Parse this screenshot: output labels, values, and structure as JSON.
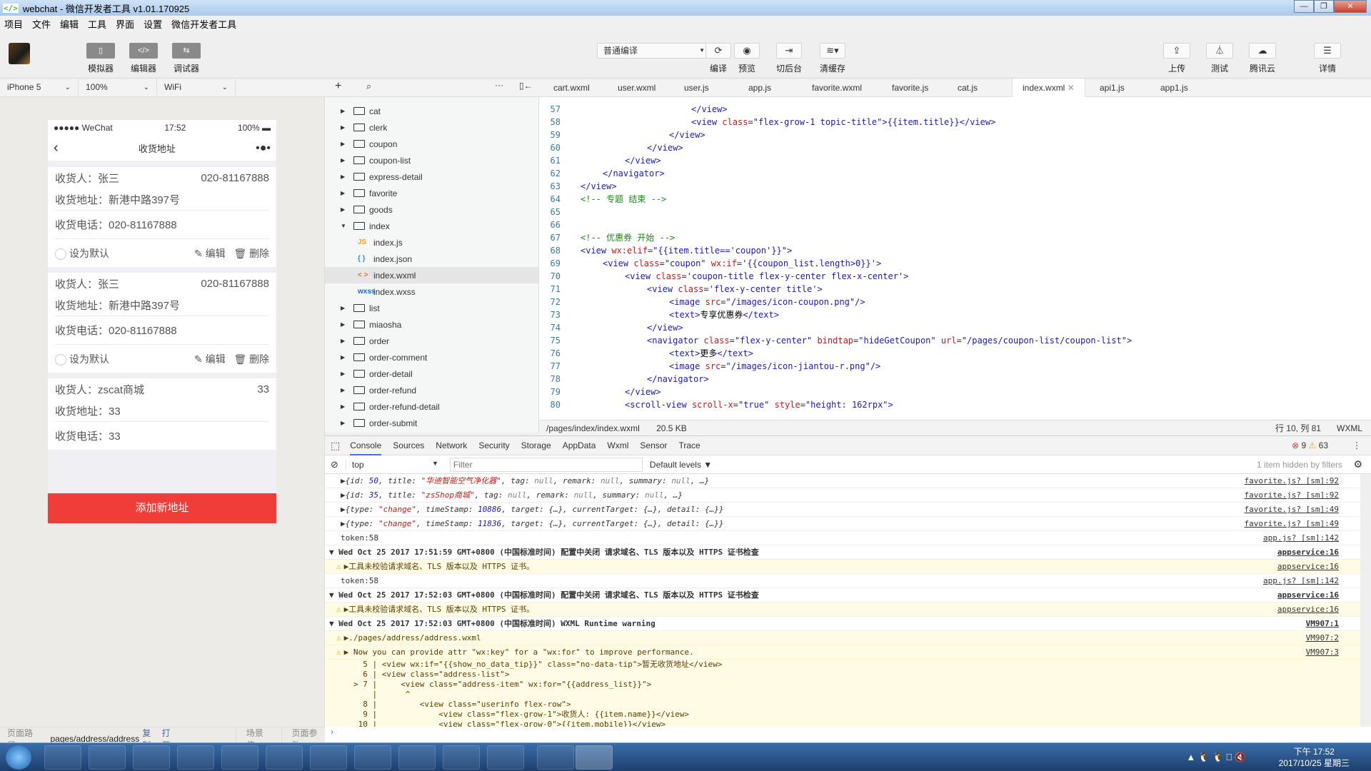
{
  "window": {
    "title": "webchat - 微信开发者工具 v1.01.170925",
    "logo": "</>"
  },
  "menu": [
    "项目",
    "文件",
    "编辑",
    "工具",
    "界面",
    "设置",
    "微信开发者工具"
  ],
  "toolbar": {
    "left": [
      {
        "label": "模拟器",
        "icon": "phone-icon",
        "glyph": "▯"
      },
      {
        "label": "编辑器",
        "icon": "code-icon",
        "glyph": "</>"
      },
      {
        "label": "调试器",
        "icon": "debug-icon",
        "glyph": "⇆"
      }
    ],
    "compile_mode": "普通编译",
    "middle": [
      {
        "label": "编译",
        "icon": "refresh-icon",
        "glyph": "⟳"
      },
      {
        "label": "预览",
        "icon": "eye-icon",
        "glyph": "◉"
      },
      {
        "label": "切后台",
        "icon": "background-icon",
        "glyph": "⇥"
      },
      {
        "label": "清缓存",
        "icon": "layers-icon",
        "glyph": "≋▾"
      }
    ],
    "right": [
      {
        "label": "上传",
        "icon": "upload-icon",
        "glyph": "⇪"
      },
      {
        "label": "测试",
        "icon": "flask-icon",
        "glyph": "⏃"
      },
      {
        "label": "腾讯云",
        "icon": "cloud-icon",
        "glyph": "☁"
      },
      {
        "label": "详情",
        "icon": "menu-icon",
        "glyph": "☰"
      }
    ]
  },
  "simulator": {
    "device": "iPhone 5",
    "zoom": "100%",
    "network": "WiFi",
    "status": {
      "carrier": "●●●●● WeChat",
      "time": "17:52",
      "battery": "100%"
    },
    "nav_title": "收货地址",
    "addresses": [
      {
        "name": "收货人：张三",
        "mobile": "020-81167888",
        "address": "收货地址：新港中路397号",
        "phone": "收货电话：020-81167888",
        "default": "设为默认",
        "edit": "编辑",
        "delete": "删除"
      },
      {
        "name": "收货人：张三",
        "mobile": "020-81167888",
        "address": "收货地址：新港中路397号",
        "phone": "收货电话：020-81167888",
        "default": "设为默认",
        "edit": "编辑",
        "delete": "删除"
      },
      {
        "name": "收货人：zscat商城",
        "mobile": "33",
        "address": "收货地址：33",
        "phone": "收货电话：33"
      }
    ],
    "add_button": "添加新地址",
    "footer": {
      "label": "页面路径",
      "path": "pages/address/address",
      "copy": "复制",
      "open": "打开",
      "scene": "场景值",
      "params": "页面参数"
    }
  },
  "filetree": {
    "items": [
      {
        "type": "folder",
        "name": "cat"
      },
      {
        "type": "folder",
        "name": "clerk"
      },
      {
        "type": "folder",
        "name": "coupon"
      },
      {
        "type": "folder",
        "name": "coupon-list"
      },
      {
        "type": "folder",
        "name": "express-detail"
      },
      {
        "type": "folder",
        "name": "favorite"
      },
      {
        "type": "folder",
        "name": "goods"
      },
      {
        "type": "folder-open",
        "name": "index"
      },
      {
        "type": "file",
        "name": "index.js",
        "icon": "JS",
        "color": "#f0a30a"
      },
      {
        "type": "file",
        "name": "index.json",
        "icon": "{ }",
        "color": "#1a9ad6"
      },
      {
        "type": "file",
        "name": "index.wxml",
        "icon": "< >",
        "color": "#f06a2a",
        "selected": true
      },
      {
        "type": "file",
        "name": "index.wxss",
        "icon": "wxss",
        "color": "#1a6ad6"
      },
      {
        "type": "folder",
        "name": "list"
      },
      {
        "type": "folder",
        "name": "miaosha"
      },
      {
        "type": "folder",
        "name": "order"
      },
      {
        "type": "folder",
        "name": "order-comment"
      },
      {
        "type": "folder",
        "name": "order-detail"
      },
      {
        "type": "folder",
        "name": "order-refund"
      },
      {
        "type": "folder",
        "name": "order-refund-detail"
      },
      {
        "type": "folder",
        "name": "order-submit"
      }
    ]
  },
  "editor": {
    "tabs": [
      "cart.wxml",
      "user.wxml",
      "user.js",
      "app.js",
      "favorite.wxml",
      "favorite.js",
      "cat.js",
      "index.wxml",
      "api1.js",
      "app1.js"
    ],
    "active_tab": "index.wxml",
    "lines": [
      {
        "n": "57",
        "indent": 5,
        "html": "<span class='tg'>&lt;/view&gt;</span>"
      },
      {
        "n": "58",
        "indent": 5,
        "html": "<span class='tg'>&lt;view</span> <span class='at'>class</span>=<span class='st'>\"flex-grow-1 topic-title\"</span><span class='tg'>&gt;</span><span class='st'>{{item.title}}</span><span class='tg'>&lt;/view&gt;</span>"
      },
      {
        "n": "59",
        "indent": 4,
        "html": "<span class='tg'>&lt;/view&gt;</span>"
      },
      {
        "n": "60",
        "indent": 3,
        "html": "<span class='tg'>&lt;/view&gt;</span>"
      },
      {
        "n": "61",
        "indent": 2,
        "html": "<span class='tg'>&lt;/view&gt;</span>"
      },
      {
        "n": "62",
        "indent": 1,
        "html": "<span class='tg'>&lt;/navigator&gt;</span>"
      },
      {
        "n": "63",
        "indent": 0,
        "html": "<span class='tg'>&lt;/view&gt;</span>"
      },
      {
        "n": "64",
        "indent": 0,
        "html": "<span class='cm'>&lt;!-- 专题 结束 --&gt;</span>"
      },
      {
        "n": "65",
        "indent": 0,
        "html": ""
      },
      {
        "n": "66",
        "indent": 0,
        "html": ""
      },
      {
        "n": "67",
        "indent": 0,
        "html": "<span class='cm'>&lt;!-- 优惠券 开始 --&gt;</span>"
      },
      {
        "n": "68",
        "indent": 0,
        "html": "<span class='tg'>&lt;view</span> <span class='at'>wx:elif</span>=<span class='st'>\"{{item.title=='coupon'}}\"</span><span class='tg'>&gt;</span>"
      },
      {
        "n": "69",
        "indent": 1,
        "html": "<span class='tg'>&lt;view</span> <span class='at'>class</span>=<span class='st'>\"coupon\"</span> <span class='at'>wx:if</span>=<span class='st'>'{{coupon_list.length&gt;0}}'</span><span class='tg'>&gt;</span>"
      },
      {
        "n": "70",
        "indent": 2,
        "html": "<span class='tg'>&lt;view</span> <span class='at'>class</span>=<span class='st'>'coupon-title flex-y-center flex-x-center'</span><span class='tg'>&gt;</span>"
      },
      {
        "n": "71",
        "indent": 3,
        "html": "<span class='tg'>&lt;view</span> <span class='at'>class</span>=<span class='st'>'flex-y-center title'</span><span class='tg'>&gt;</span>"
      },
      {
        "n": "72",
        "indent": 4,
        "html": "<span class='tg'>&lt;image</span> <span class='at'>src</span>=<span class='st'>\"/images/icon-coupon.png\"</span><span class='tg'>/&gt;</span>"
      },
      {
        "n": "73",
        "indent": 4,
        "html": "<span class='tg'>&lt;text&gt;</span><span class='bk'>专享优惠券</span><span class='tg'>&lt;/text&gt;</span>"
      },
      {
        "n": "74",
        "indent": 3,
        "html": "<span class='tg'>&lt;/view&gt;</span>"
      },
      {
        "n": "75",
        "indent": 3,
        "html": "<span class='tg'>&lt;navigator</span> <span class='at'>class</span>=<span class='st'>\"flex-y-center\"</span> <span class='at'>bindtap</span>=<span class='st'>\"hideGetCoupon\"</span> <span class='at'>url</span>=<span class='st'>\"/pages/coupon-list/coupon-list\"</span><span class='tg'>&gt;</span>"
      },
      {
        "n": "76",
        "indent": 4,
        "html": "<span class='tg'>&lt;text&gt;</span><span class='bk'>更多</span><span class='tg'>&lt;/text&gt;</span>"
      },
      {
        "n": "77",
        "indent": 4,
        "html": "<span class='tg'>&lt;image</span> <span class='at'>src</span>=<span class='st'>\"/images/icon-jiantou-r.png\"</span><span class='tg'>/&gt;</span>"
      },
      {
        "n": "78",
        "indent": 3,
        "html": "<span class='tg'>&lt;/navigator&gt;</span>"
      },
      {
        "n": "79",
        "indent": 2,
        "html": "<span class='tg'>&lt;/view&gt;</span>"
      },
      {
        "n": "80",
        "indent": 2,
        "html": "<span class='tg'>&lt;scroll-view</span> <span class='at'>scroll-x</span>=<span class='st'>\"true\"</span> <span class='at'>style</span>=<span class='st'>\"height: 162rpx\"</span><span class='tg'>&gt;</span>"
      }
    ],
    "status": {
      "path": "/pages/index/index.wxml",
      "size": "20.5 KB",
      "cursor": "行 10, 列 81",
      "lang": "WXML"
    }
  },
  "devtools": {
    "tabs": [
      "Console",
      "Sources",
      "Network",
      "Security",
      "Storage",
      "AppData",
      "Wxml",
      "Sensor",
      "Trace"
    ],
    "active": "Console",
    "errors": "9",
    "warnings": "63",
    "context": "top",
    "filter_placeholder": "Filter",
    "levels": "Default levels ▼",
    "hidden": "1 item hidden by filters",
    "rows": [
      {
        "kind": "obj",
        "html": "▶<span class='it'>{id: <span class='num'>50</span>, title: <span class='strv'>\"华迪智能空气净化器\"</span>, tag: <span class='nul'>null</span>, remark: <span class='nul'>null</span>, summary: <span class='nul'>null</span>, …}</span>",
        "src": "favorite.js? [sm]:92"
      },
      {
        "kind": "obj",
        "html": "▶<span class='it'>{id: <span class='num'>35</span>, title: <span class='strv'>\"zsShop商城\"</span>, tag: <span class='nul'>null</span>, remark: <span class='nul'>null</span>, summary: <span class='nul'>null</span>, …}</span>",
        "src": "favorite.js? [sm]:92"
      },
      {
        "kind": "obj",
        "html": "▶<span class='it'>{type: <span class='strv'>\"change\"</span>, timeStamp: <span class='num'>10886</span>, target: {…}, currentTarget: {…}, detail: {…}}</span>",
        "src": "favorite.js? [sm]:49"
      },
      {
        "kind": "obj",
        "html": "▶<span class='it'>{type: <span class='strv'>\"change\"</span>, timeStamp: <span class='num'>11836</span>, target: {…}, currentTarget: {…}, detail: {…}}</span>",
        "src": "favorite.js? [sm]:49"
      },
      {
        "kind": "log",
        "html": "token:58",
        "src": "app.js? [sm]:142"
      },
      {
        "kind": "group",
        "html": "▼ Wed Oct 25 2017 17:51:59 GMT+0800 (中国标准时间) 配置中关闭 请求域名、TLS 版本以及 HTTPS 证书检查",
        "src": "appservice:16"
      },
      {
        "kind": "warn",
        "html": "<span class='warnico'>⚠</span>▶工具未校验请求域名、TLS 版本以及 HTTPS 证书。",
        "src": "appservice:16"
      },
      {
        "kind": "log",
        "html": "token:58",
        "src": "app.js? [sm]:142"
      },
      {
        "kind": "group",
        "html": "▼ Wed Oct 25 2017 17:52:03 GMT+0800 (中国标准时间) 配置中关闭 请求域名、TLS 版本以及 HTTPS 证书检查",
        "src": "appservice:16"
      },
      {
        "kind": "warn",
        "html": "<span class='warnico'>⚠</span>▶工具未校验请求域名、TLS 版本以及 HTTPS 证书。",
        "src": "appservice:16"
      },
      {
        "kind": "group",
        "html": "▼ Wed Oct 25 2017 17:52:03 GMT+0800 (中国标准时间) WXML Runtime warning",
        "src": "VM907:1"
      },
      {
        "kind": "warn",
        "html": "<span class='warnico'>⚠</span>▶./pages/address/address.wxml",
        "src": "VM907:2"
      },
      {
        "kind": "warn",
        "html": "<span class='warnico'>⚠</span>▶ Now you can provide attr \"wx:key\" for a \"wx:for\" to improve performance.",
        "src": "VM907:3"
      }
    ],
    "context_lines": [
      "  5 | &lt;view wx:if=\"{{show_no_data_tip}}\" class=\"no-data-tip\"&gt;暂无收货地址&lt;/view&gt;",
      "  6 | &lt;view class=\"address-list\"&gt;",
      "&gt; 7 |     &lt;view class=\"address-item\" wx:for=\"{{address_list}}\"&gt;",
      "    |      ^",
      "  8 |         &lt;view class=\"userinfo flex-row\"&gt;",
      "  9 |             &lt;view class=\"flex-grow-1\"&gt;收货人: {{item.name}}&lt;/view&gt;",
      " 10 |             &lt;view class=\"flex-grow-0\"&gt;{{item.mobile}}&lt;/view&gt;"
    ]
  },
  "taskbar": {
    "time": "下午 17:52",
    "date": "2017/10/25 星期三"
  }
}
